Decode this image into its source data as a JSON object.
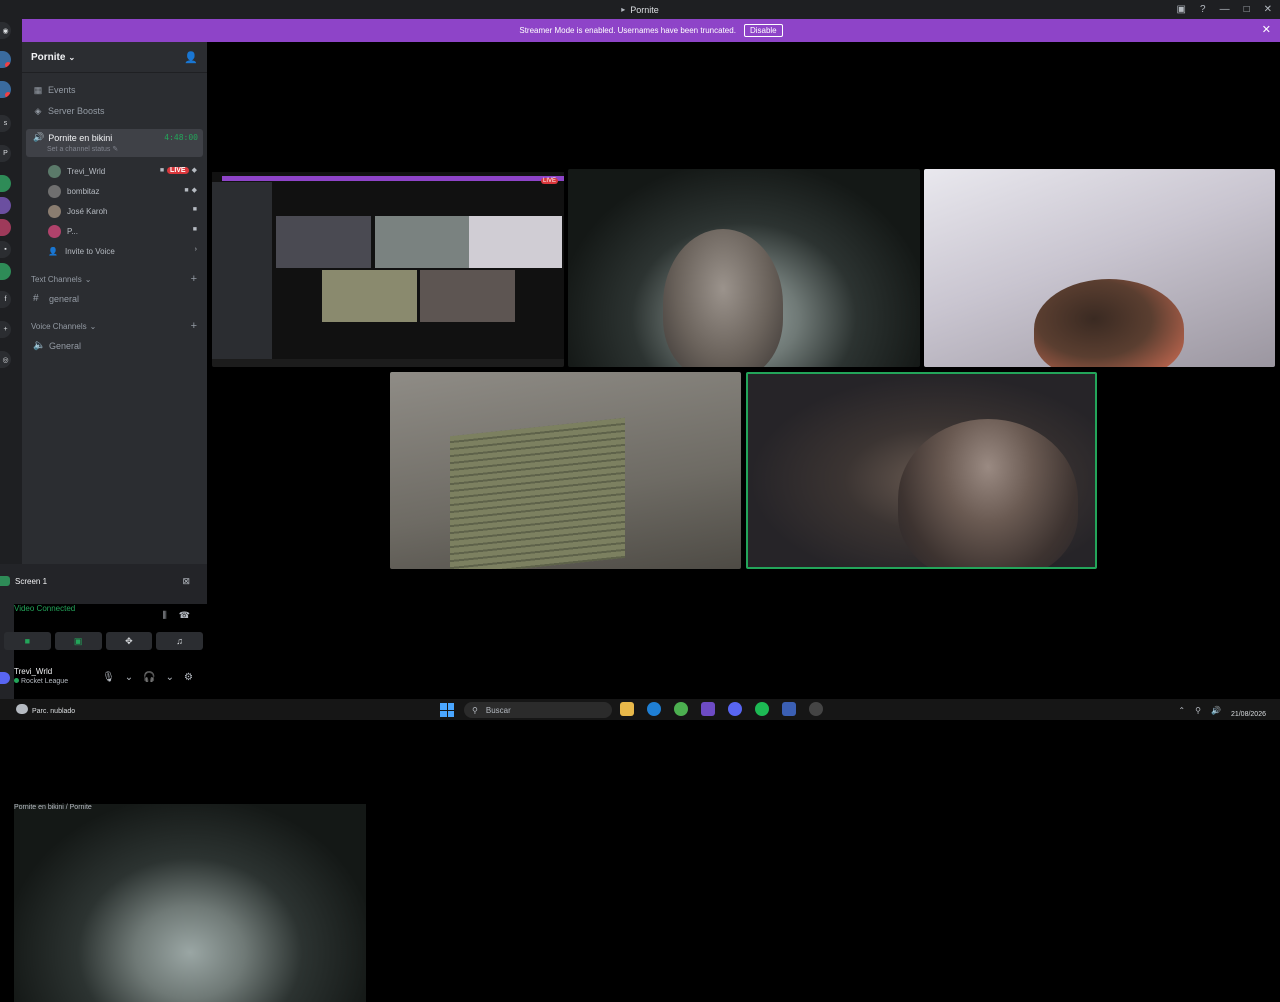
{
  "window": {
    "title": "Pornite",
    "title_icon": "▸"
  },
  "banner": {
    "text": "Streamer Mode is enabled. Usernames have been truncated.",
    "button": "Disable",
    "bg": "#8e44c8"
  },
  "server": {
    "name": "Pornite",
    "nav": [
      {
        "label": "Events",
        "icon": "calendar-icon"
      },
      {
        "label": "Server Boosts",
        "icon": "boost-icon"
      }
    ],
    "active_voice": {
      "name": "Pornite en bikini",
      "status_placeholder": "Set a channel status",
      "timer": "4:48:00"
    },
    "voice_users": [
      {
        "name": "Trevi_Wrld",
        "live": "LIVE"
      },
      {
        "name": "bombitaz"
      },
      {
        "name": "José Karoh"
      },
      {
        "name": "P..."
      }
    ],
    "invite": "Invite to Voice",
    "text_category": "Text Channels",
    "text_channels": [
      "general"
    ],
    "voice_category": "Voice Channels",
    "voice_channels": [
      "General"
    ]
  },
  "panel": {
    "screen_label": "Screen 1",
    "video_status": "Video Connected",
    "video_location": "Pornite en bikini / Pornite",
    "username": "Trevi_Wrld",
    "activity": "Rocket League"
  },
  "colors": {
    "accent": "#8e44c8",
    "online": "#23a55a",
    "live": "#da373c",
    "speaking_border": "#23a55a"
  },
  "taskbar": {
    "weather": "Parc. nublado",
    "search_placeholder": "Buscar",
    "date": "21/08/2026"
  }
}
